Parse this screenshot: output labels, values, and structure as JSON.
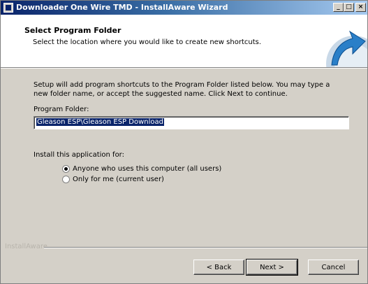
{
  "window": {
    "title": "Downloader One Wire TMD - InstallAware Wizard",
    "min_glyph": "_",
    "max_glyph": "□",
    "close_glyph": "×"
  },
  "header": {
    "title": "Select Program Folder",
    "subtitle": "Select the location where you would like to create new shortcuts."
  },
  "body": {
    "description": "Setup will add program shortcuts to the Program Folder listed below. You may type a new folder name, or accept the suggested name. Click Next to continue.",
    "program_folder_label": "Program Folder:",
    "program_folder_value": "Gleason ESP\\Gleason ESP Download",
    "install_for_label": "Install this application for:",
    "options": [
      {
        "label": "Anyone who uses this computer (all users)",
        "selected": true
      },
      {
        "label": "Only for me (current user)",
        "selected": false
      }
    ]
  },
  "footer": {
    "brand": "InstallAware",
    "back_label": "< Back",
    "next_label": "Next >",
    "cancel_label": "Cancel"
  },
  "colors": {
    "titlebar_start": "#0a246a",
    "titlebar_end": "#a6caf0",
    "dialog_face": "#d4d0c8",
    "selection": "#0a246a"
  }
}
